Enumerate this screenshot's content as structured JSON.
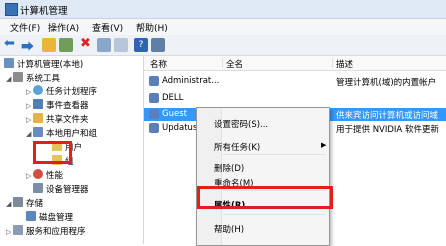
{
  "window": {
    "title": "计算机管理"
  },
  "menubar": {
    "file": "文件(F)",
    "action": "操作(A)",
    "view": "查看(V)",
    "help": "帮助(H)"
  },
  "tree": {
    "root": "计算机管理(本地)",
    "system_tools": "系统工具",
    "task_scheduler": "任务计划程序",
    "event_viewer": "事件查看器",
    "shared_folders": "共享文件夹",
    "local_users": "本地用户和组",
    "users": "用户",
    "groups": "组",
    "performance": "性能",
    "device_manager": "设备管理器",
    "storage": "存储",
    "disk_mgmt": "磁盘管理",
    "services": "服务和应用程序"
  },
  "list": {
    "headers": {
      "name": "名称",
      "fullname": "全名",
      "desc": "描述"
    },
    "rows": [
      {
        "name": "Administrat...",
        "desc": "管理计算机(域)的内置帐户"
      },
      {
        "name": "DELL",
        "desc": ""
      },
      {
        "name": "Guest",
        "desc": "供来宾访问计算机或访问域"
      },
      {
        "name": "UpdatusUse",
        "desc": "用于提供 NVIDIA 软件更新"
      }
    ]
  },
  "context_menu": {
    "set_password": "设置密码(S)...",
    "all_tasks": "所有任务(K)",
    "delete": "删除(D)",
    "rename": "重命名(M)",
    "properties": "属性(R)",
    "help": "帮助(H)"
  },
  "colors": {
    "selection": "#3399ff",
    "highlight_box": "#e02020",
    "title_bg": "#dfe9f5"
  }
}
